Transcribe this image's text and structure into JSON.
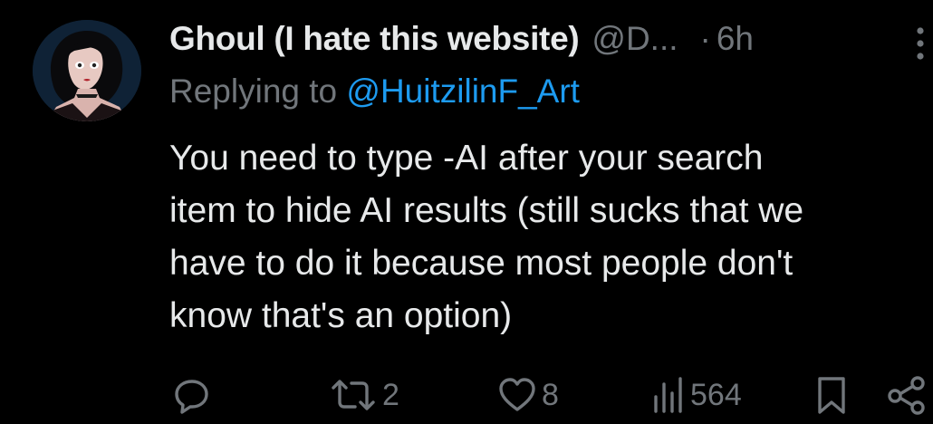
{
  "author": {
    "display_name": "Ghoul (I hate this website)",
    "handle": "@D...",
    "separator": "·",
    "timestamp": "6h",
    "avatar_icon": "avatar-icon"
  },
  "reply": {
    "prefix": "Replying to",
    "mention": "@HuitzilinF_Art"
  },
  "tweet": {
    "lines": [
      "You need to type -AI after your search",
      "item to hide AI results (still sucks that we",
      "have to do it because most people don't",
      "know that's an option)"
    ]
  },
  "actions": {
    "reply_icon": "reply-icon",
    "repost_icon": "repost-icon",
    "repost_count": "2",
    "like_icon": "heart-icon",
    "like_count": "8",
    "views_icon": "views-icon",
    "views_count": "564",
    "bookmark_icon": "bookmark-icon",
    "share_icon": "share-icon",
    "more_icon": "more-icon"
  },
  "colors": {
    "background": "#000000",
    "text": "#e7e9ea",
    "muted": "#71767b",
    "link": "#1d9bf0"
  }
}
